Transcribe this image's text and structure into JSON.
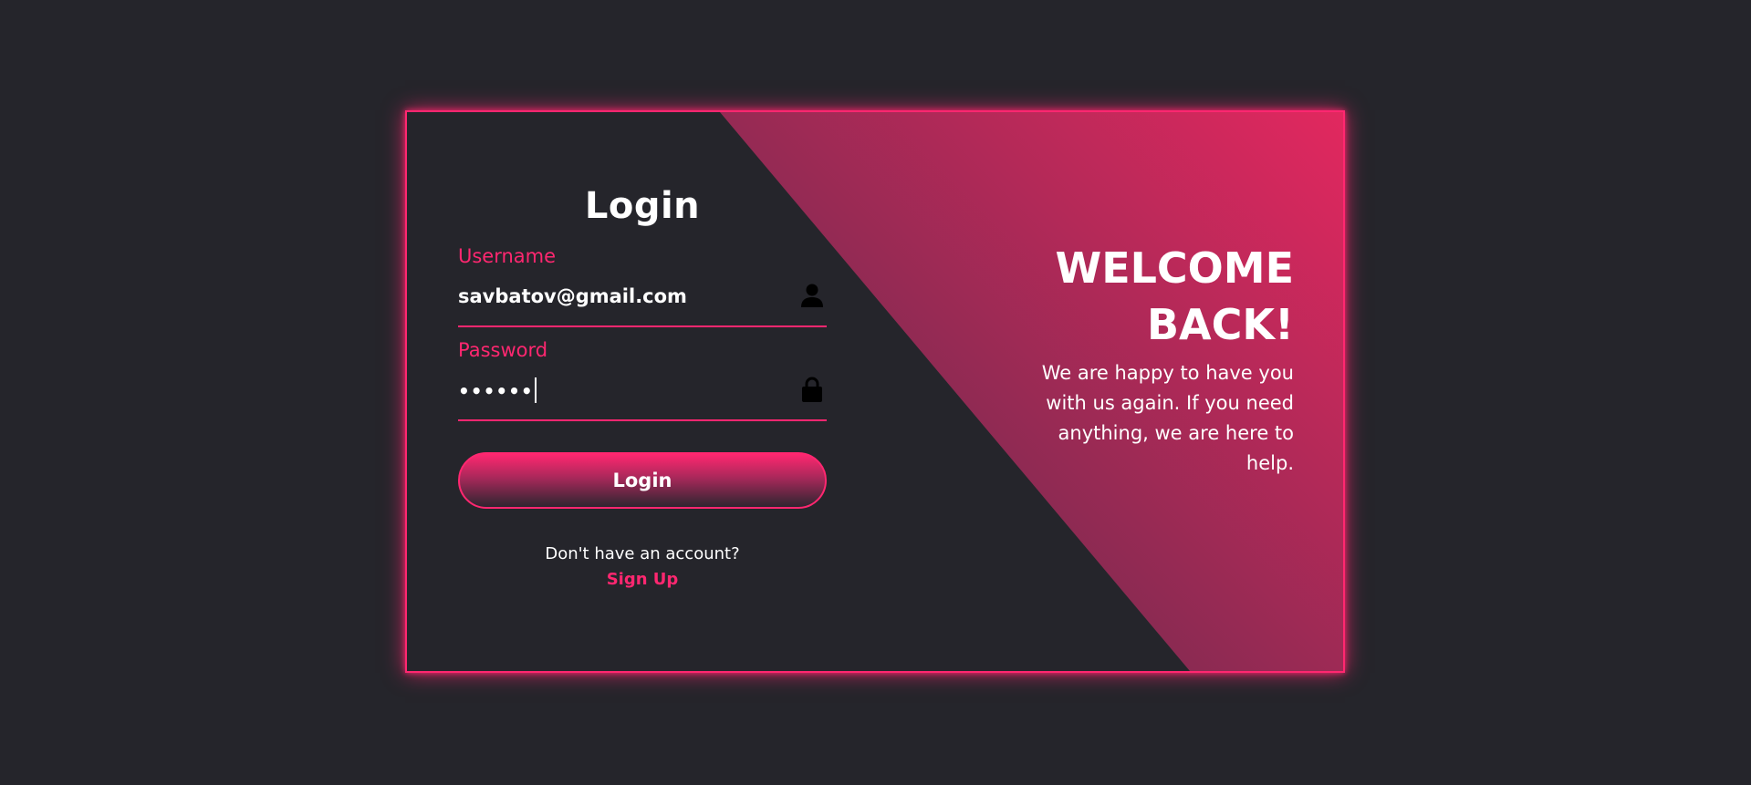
{
  "colors": {
    "background": "#25252b",
    "accent": "#ff2770",
    "text": "#ffffff"
  },
  "login_form": {
    "title": "Login",
    "username": {
      "label": "Username",
      "value": "savbatov@gmail.com",
      "icon": "user-icon"
    },
    "password": {
      "label": "Password",
      "value_masked": "••••••",
      "icon": "lock-icon"
    },
    "submit_label": "Login",
    "no_account_text": "Don't have an account?",
    "signup_label": "Sign Up"
  },
  "welcome_panel": {
    "title": "WELCOME BACK!",
    "message": "We are happy to have you with us again. If you need anything, we are here to help."
  }
}
